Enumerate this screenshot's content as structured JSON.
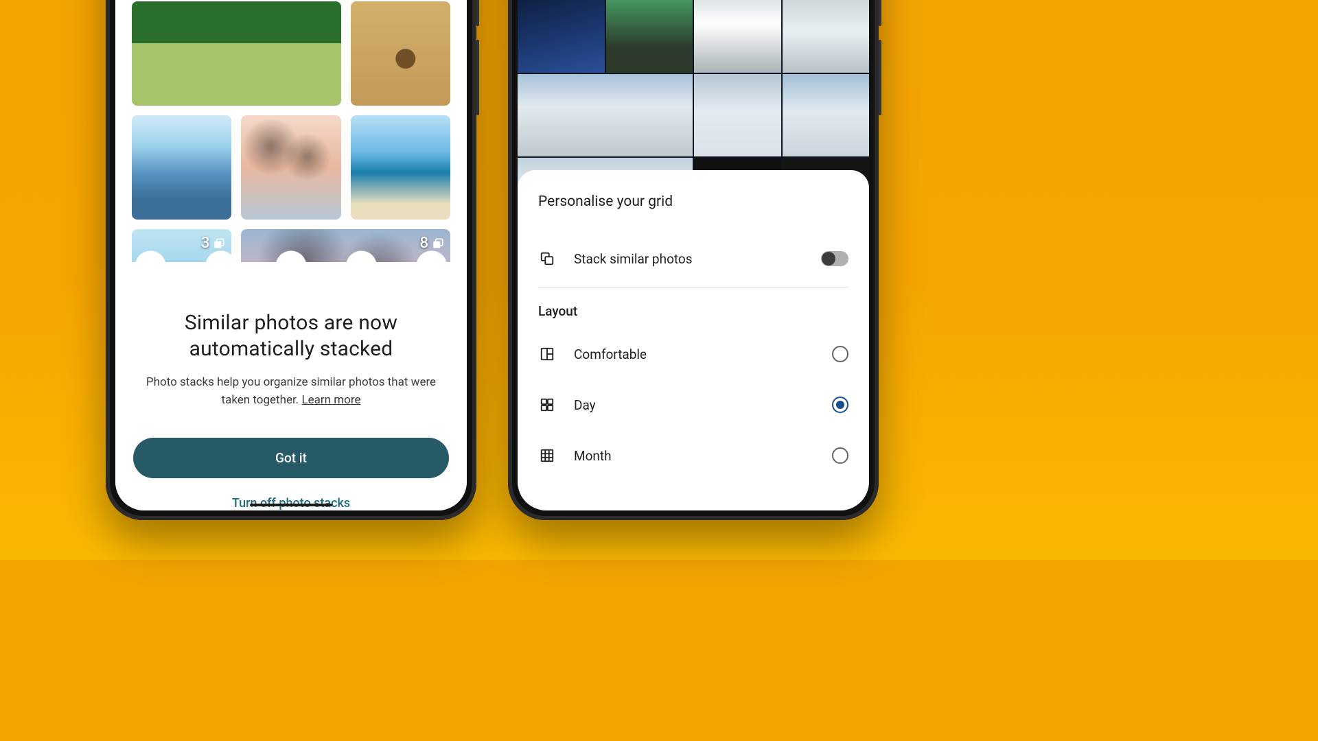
{
  "left": {
    "badges": {
      "portrait": "3",
      "sunset": "8"
    },
    "sheet": {
      "title_line1": "Similar photos are now",
      "title_line2": "automatically stacked",
      "subtitle": "Photo stacks help you organize similar photos that were taken together. ",
      "learn_more": "Learn more",
      "primary_button": "Got it",
      "secondary_button": "Turn off photo stacks"
    }
  },
  "right": {
    "sheet_title": "Personalise your grid",
    "stack_toggle_label": "Stack similar photos",
    "stack_toggle_on": false,
    "layout_section": "Layout",
    "options": [
      {
        "label": "Comfortable",
        "selected": false
      },
      {
        "label": "Day",
        "selected": true
      },
      {
        "label": "Month",
        "selected": false
      }
    ]
  }
}
